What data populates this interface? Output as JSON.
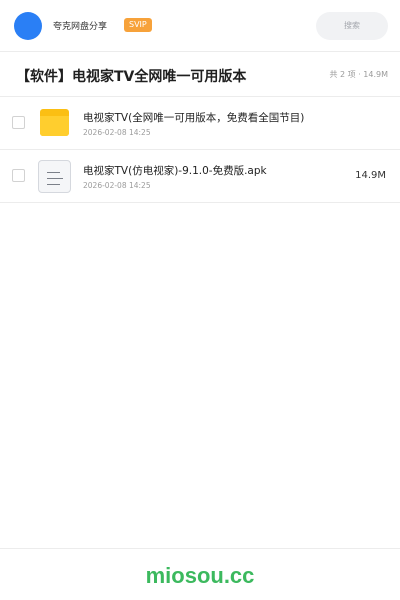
{
  "header": {
    "username": "夸克网盘分享",
    "badge": "SVIP",
    "search_placeholder": "搜索"
  },
  "share": {
    "title": "【软件】电视家TV全网唯一可用版本",
    "meta": "共 2 项 · 14.9M"
  },
  "files": [
    {
      "icon": "folder-icon",
      "name": "电视家TV(全网唯一可用版本，免费看全国节目)",
      "date": "2026-02-08 14:25",
      "size": ""
    },
    {
      "icon": "document-file-icon",
      "name": "电视家TV(仿电视家)-9.1.0-免费版.apk",
      "date": "2026-02-08 14:25",
      "size": "14.9M"
    }
  ],
  "footer": {
    "brand": "miosou.cc"
  },
  "colors": {
    "accent": "#2a7ff5",
    "svip": "#f7a23a",
    "folder": "#ffce2e",
    "brand": "#3cb95e"
  }
}
